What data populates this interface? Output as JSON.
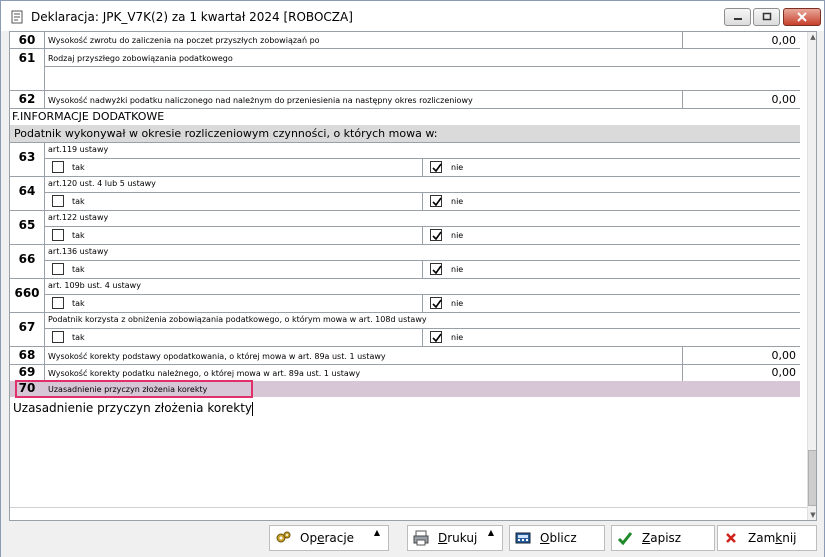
{
  "window": {
    "title": "Deklaracja: JPK_V7K(2) za 1 kwartał 2024   [ROBOCZA]"
  },
  "rows_top": [
    {
      "num": "60",
      "label": "Wysokość zwrotu do zaliczenia na poczet przyszłych zobowiązań po",
      "value": "0,00"
    },
    {
      "num": "61",
      "label": "Rodzaj przyszłego zobowiązania podatkowego",
      "value": ""
    },
    {
      "num": "62",
      "label": "Wysokość nadwyżki podatku naliczonego nad należnym do przeniesienia na następny okres rozliczeniowy",
      "value": "0,00"
    }
  ],
  "section_f": "F.INFORMACJE DODATKOWE",
  "subsection": "Podatnik wykonywał w okresie rozliczeniowym czynności, o których mowa w:",
  "check_rows": [
    {
      "num": "63",
      "label": "art.119 ustawy",
      "tak": false,
      "nie": true
    },
    {
      "num": "64",
      "label": "art.120 ust. 4 lub 5 ustawy",
      "tak": false,
      "nie": true
    },
    {
      "num": "65",
      "label": "art.122 ustawy",
      "tak": false,
      "nie": true
    },
    {
      "num": "66",
      "label": "art.136 ustawy",
      "tak": false,
      "nie": true
    },
    {
      "num": "660",
      "label": "art. 109b ust. 4 ustawy",
      "tak": false,
      "nie": true
    },
    {
      "num": "67",
      "label": "Podatnik korzysta z obniżenia zobowiązania podatkowego, o którym mowa w art. 108d ustawy",
      "tak": false,
      "nie": true
    }
  ],
  "tak_label": "tak",
  "nie_label": "nie",
  "rows_bottom": [
    {
      "num": "68",
      "label": "Wysokość korekty podstawy opodatkowania, o której mowa w art. 89a ust. 1 ustawy",
      "value": "0,00"
    },
    {
      "num": "69",
      "label": "Wysokość korekty podatku należnego, o której mowa w art. 89a ust. 1 ustawy",
      "value": "0,00"
    }
  ],
  "row70": {
    "num": "70",
    "label": "Uzasadnienie przyczyn złożenia korekty"
  },
  "textarea_value": "Uzasadnienie przyczyn złożenia korekty",
  "buttons": {
    "operacje_pre": "Op",
    "operacje_u": "e",
    "operacje_post": "racje",
    "drukuj_pre": "",
    "drukuj_u": "D",
    "drukuj_post": "rukuj",
    "oblicz_pre": "",
    "oblicz_u": "O",
    "oblicz_post": "blicz",
    "zapisz_pre": "",
    "zapisz_u": "Z",
    "zapisz_post": "apisz",
    "zamknij_pre": "Zam",
    "zamknij_u": "k",
    "zamknij_post": "nij"
  },
  "colors": {
    "row70_bg": "#d6c6d6",
    "highlight": "#e0306a",
    "section_bg": "#dadada"
  }
}
